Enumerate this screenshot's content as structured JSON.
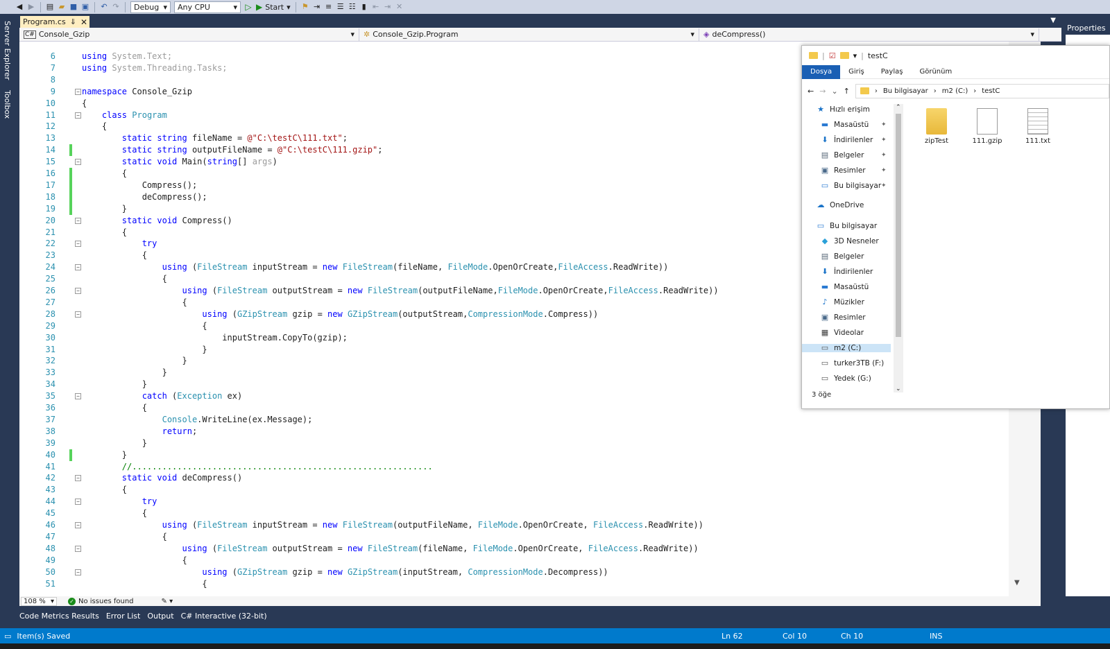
{
  "toolbar": {
    "config": "Debug",
    "platform": "Any CPU",
    "start": "Start"
  },
  "sidebar": {
    "server_explorer": "Server Explorer",
    "toolbox": "Toolbox"
  },
  "tab": {
    "file": "Program.cs",
    "pin": "⇓",
    "close": "✕"
  },
  "nav": {
    "project": "Console_Gzip",
    "class": "Console_Gzip.Program",
    "member": "deCompress()"
  },
  "properties": {
    "title": "Properties"
  },
  "code": {
    "lines": [
      {
        "n": "6",
        "segs": [
          [
            "k",
            "using"
          ],
          [
            "g",
            " System.Text;"
          ]
        ],
        "dim": true
      },
      {
        "n": "7",
        "segs": [
          [
            "k",
            "using"
          ],
          [
            "g",
            " System.Threading.Tasks;"
          ]
        ],
        "dim": true
      },
      {
        "n": "8",
        "segs": []
      },
      {
        "n": "9",
        "segs": [
          [
            "k",
            "namespace"
          ],
          [
            "",
            " Console_Gzip"
          ]
        ],
        "fold": "−"
      },
      {
        "n": "10",
        "segs": [
          [
            "",
            "{"
          ]
        ]
      },
      {
        "n": "11",
        "segs": [
          [
            "",
            "    "
          ],
          [
            "k",
            "class"
          ],
          [
            "",
            " "
          ],
          [
            "t",
            "Program"
          ]
        ],
        "fold": "−"
      },
      {
        "n": "12",
        "segs": [
          [
            "",
            "    {"
          ]
        ]
      },
      {
        "n": "13",
        "segs": [
          [
            "",
            "        "
          ],
          [
            "k",
            "static string"
          ],
          [
            "",
            " fileName = "
          ],
          [
            "s",
            "@\"C:\\testC\\111.txt\""
          ],
          [
            ";"
          ]
        ]
      },
      {
        "n": "14",
        "segs": [
          [
            "",
            "        "
          ],
          [
            "k",
            "static string"
          ],
          [
            "",
            " outputFileName = "
          ],
          [
            "s",
            "@\"C:\\testC\\111.gzip\""
          ],
          [
            ";"
          ]
        ],
        "changed": true
      },
      {
        "n": "15",
        "segs": [
          [
            "",
            "        "
          ],
          [
            "k",
            "static void"
          ],
          [
            "",
            " Main("
          ],
          [
            "k",
            "string"
          ],
          [
            "",
            "[] "
          ],
          [
            "g",
            "args"
          ],
          [
            "",
            ")"
          ]
        ],
        "fold": "−"
      },
      {
        "n": "16",
        "segs": [
          [
            "",
            "        {"
          ]
        ],
        "changed": true
      },
      {
        "n": "17",
        "segs": [
          [
            "",
            "            Compress();"
          ]
        ],
        "changed": true
      },
      {
        "n": "18",
        "segs": [
          [
            "",
            "            deCompress();"
          ]
        ],
        "changed": true
      },
      {
        "n": "19",
        "segs": [
          [
            "",
            "        }"
          ]
        ],
        "changed": true
      },
      {
        "n": "20",
        "segs": [
          [
            "",
            "        "
          ],
          [
            "k",
            "static void"
          ],
          [
            "",
            " Compress()"
          ]
        ],
        "fold": "−"
      },
      {
        "n": "21",
        "segs": [
          [
            "",
            "        {"
          ]
        ]
      },
      {
        "n": "22",
        "segs": [
          [
            "",
            "            "
          ],
          [
            "k",
            "try"
          ]
        ],
        "fold": "−"
      },
      {
        "n": "23",
        "segs": [
          [
            "",
            "            {"
          ]
        ]
      },
      {
        "n": "24",
        "segs": [
          [
            "",
            "                "
          ],
          [
            "k",
            "using"
          ],
          [
            "",
            " ("
          ],
          [
            "t",
            "FileStream"
          ],
          [
            "",
            " inputStream = "
          ],
          [
            "k",
            "new"
          ],
          [
            "",
            " "
          ],
          [
            "t",
            "FileStream"
          ],
          [
            "",
            "(fileName, "
          ],
          [
            "t",
            "FileMode"
          ],
          [
            "",
            ".OpenOrCreate,"
          ],
          [
            "t",
            "FileAccess"
          ],
          [
            "",
            ".ReadWrite))"
          ]
        ],
        "fold": "−"
      },
      {
        "n": "25",
        "segs": [
          [
            "",
            "                {"
          ]
        ]
      },
      {
        "n": "26",
        "segs": [
          [
            "",
            "                    "
          ],
          [
            "k",
            "using"
          ],
          [
            "",
            " ("
          ],
          [
            "t",
            "FileStream"
          ],
          [
            "",
            " outputStream = "
          ],
          [
            "k",
            "new"
          ],
          [
            "",
            " "
          ],
          [
            "t",
            "FileStream"
          ],
          [
            "",
            "(outputFileName,"
          ],
          [
            "t",
            "FileMode"
          ],
          [
            "",
            ".OpenOrCreate,"
          ],
          [
            "t",
            "FileAccess"
          ],
          [
            "",
            ".ReadWrite))"
          ]
        ],
        "fold": "−"
      },
      {
        "n": "27",
        "segs": [
          [
            "",
            "                    {"
          ]
        ]
      },
      {
        "n": "28",
        "segs": [
          [
            "",
            "                        "
          ],
          [
            "k",
            "using"
          ],
          [
            "",
            " ("
          ],
          [
            "t",
            "GZipStream"
          ],
          [
            "",
            " gzip = "
          ],
          [
            "k",
            "new"
          ],
          [
            "",
            " "
          ],
          [
            "t",
            "GZipStream"
          ],
          [
            "",
            "(outputStream,"
          ],
          [
            "t",
            "CompressionMode"
          ],
          [
            "",
            ".Compress))"
          ]
        ],
        "fold": "−"
      },
      {
        "n": "29",
        "segs": [
          [
            "",
            "                        {"
          ]
        ]
      },
      {
        "n": "30",
        "segs": [
          [
            "",
            "                            inputStream.CopyTo(gzip);"
          ]
        ]
      },
      {
        "n": "31",
        "segs": [
          [
            "",
            "                        }"
          ]
        ]
      },
      {
        "n": "32",
        "segs": [
          [
            "",
            "                    }"
          ]
        ]
      },
      {
        "n": "33",
        "segs": [
          [
            "",
            "                }"
          ]
        ]
      },
      {
        "n": "34",
        "segs": [
          [
            "",
            "            }"
          ]
        ]
      },
      {
        "n": "35",
        "segs": [
          [
            "",
            "            "
          ],
          [
            "k",
            "catch"
          ],
          [
            "",
            " ("
          ],
          [
            "t",
            "Exception"
          ],
          [
            "",
            " ex)"
          ]
        ],
        "fold": "−"
      },
      {
        "n": "36",
        "segs": [
          [
            "",
            "            {"
          ]
        ]
      },
      {
        "n": "37",
        "segs": [
          [
            "",
            "                "
          ],
          [
            "t",
            "Console"
          ],
          [
            "",
            ".WriteLine(ex.Message);"
          ]
        ]
      },
      {
        "n": "38",
        "segs": [
          [
            "",
            "                "
          ],
          [
            "k",
            "return"
          ],
          [
            "",
            ";"
          ]
        ]
      },
      {
        "n": "39",
        "segs": [
          [
            "",
            "            }"
          ]
        ]
      },
      {
        "n": "40",
        "segs": [
          [
            "",
            "        }"
          ]
        ],
        "changed": true
      },
      {
        "n": "41",
        "segs": [
          [
            "",
            "        "
          ],
          [
            "c",
            "//............................................................"
          ]
        ]
      },
      {
        "n": "42",
        "segs": [
          [
            "",
            "        "
          ],
          [
            "k",
            "static void"
          ],
          [
            "",
            " deCompress()"
          ]
        ],
        "fold": "−"
      },
      {
        "n": "43",
        "segs": [
          [
            "",
            "        {"
          ]
        ]
      },
      {
        "n": "44",
        "segs": [
          [
            "",
            "            "
          ],
          [
            "k",
            "try"
          ]
        ],
        "fold": "−"
      },
      {
        "n": "45",
        "segs": [
          [
            "",
            "            {"
          ]
        ]
      },
      {
        "n": "46",
        "segs": [
          [
            "",
            "                "
          ],
          [
            "k",
            "using"
          ],
          [
            "",
            " ("
          ],
          [
            "t",
            "FileStream"
          ],
          [
            "",
            " inputStream = "
          ],
          [
            "k",
            "new"
          ],
          [
            "",
            " "
          ],
          [
            "t",
            "FileStream"
          ],
          [
            "",
            "(outputFileName, "
          ],
          [
            "t",
            "FileMode"
          ],
          [
            "",
            ".OpenOrCreate, "
          ],
          [
            "t",
            "FileAccess"
          ],
          [
            "",
            ".ReadWrite))"
          ]
        ],
        "fold": "−"
      },
      {
        "n": "47",
        "segs": [
          [
            "",
            "                {"
          ]
        ]
      },
      {
        "n": "48",
        "segs": [
          [
            "",
            "                    "
          ],
          [
            "k",
            "using"
          ],
          [
            "",
            " ("
          ],
          [
            "t",
            "FileStream"
          ],
          [
            "",
            " outputStream = "
          ],
          [
            "k",
            "new"
          ],
          [
            "",
            " "
          ],
          [
            "t",
            "FileStream"
          ],
          [
            "",
            "(fileName, "
          ],
          [
            "t",
            "FileMode"
          ],
          [
            "",
            ".OpenOrCreate, "
          ],
          [
            "t",
            "FileAccess"
          ],
          [
            "",
            ".ReadWrite))"
          ]
        ],
        "fold": "−"
      },
      {
        "n": "49",
        "segs": [
          [
            "",
            "                    {"
          ]
        ]
      },
      {
        "n": "50",
        "segs": [
          [
            "",
            "                        "
          ],
          [
            "k",
            "using"
          ],
          [
            "",
            " ("
          ],
          [
            "t",
            "GZipStream"
          ],
          [
            "",
            " gzip = "
          ],
          [
            "k",
            "new"
          ],
          [
            "",
            " "
          ],
          [
            "t",
            "GZipStream"
          ],
          [
            "",
            "(inputStream, "
          ],
          [
            "t",
            "CompressionMode"
          ],
          [
            "",
            ".Decompress))"
          ]
        ],
        "fold": "−"
      },
      {
        "n": "51",
        "segs": [
          [
            "",
            "                        {"
          ]
        ]
      }
    ]
  },
  "editor_status": {
    "zoom": "108 %",
    "issues": "No issues found"
  },
  "bottom_tabs": [
    "Code Metrics Results",
    "Error List",
    "Output",
    "C# Interactive (32-bit)"
  ],
  "status": {
    "message": "Item(s) Saved",
    "ln": "Ln 62",
    "col": "Col 10",
    "ch": "Ch 10",
    "ins": "INS"
  },
  "explorer": {
    "title": "testC",
    "ribbon_tabs": [
      "Dosya",
      "Giriş",
      "Paylaş",
      "Görünüm"
    ],
    "address": [
      "Bu bilgisayar",
      "m2 (C:)",
      "testC"
    ],
    "nav": [
      {
        "label": "Hızlı erişim",
        "icon": "star-icon",
        "indent": 0
      },
      {
        "label": "Masaüstü",
        "icon": "desktop-icon",
        "indent": 1,
        "pin": true
      },
      {
        "label": "İndirilenler",
        "icon": "download-icon",
        "indent": 1,
        "pin": true
      },
      {
        "label": "Belgeler",
        "icon": "document-icon",
        "indent": 1,
        "pin": true
      },
      {
        "label": "Resimler",
        "icon": "pictures-icon",
        "indent": 1,
        "pin": true
      },
      {
        "label": "Bu bilgisayar",
        "icon": "computer-icon",
        "indent": 1,
        "pin": true
      },
      {
        "label": "OneDrive",
        "icon": "cloud-icon",
        "indent": 0
      },
      {
        "label": "Bu bilgisayar",
        "icon": "computer-icon",
        "indent": 0
      },
      {
        "label": "3D Nesneler",
        "icon": "cube-icon",
        "indent": 1
      },
      {
        "label": "Belgeler",
        "icon": "document-icon",
        "indent": 1
      },
      {
        "label": "İndirilenler",
        "icon": "download-icon",
        "indent": 1
      },
      {
        "label": "Masaüstü",
        "icon": "desktop-icon",
        "indent": 1
      },
      {
        "label": "Müzikler",
        "icon": "music-icon",
        "indent": 1
      },
      {
        "label": "Resimler",
        "icon": "pictures-icon",
        "indent": 1
      },
      {
        "label": "Videolar",
        "icon": "video-icon",
        "indent": 1
      },
      {
        "label": "m2 (C:)",
        "icon": "drive-icon",
        "indent": 1,
        "selected": true
      },
      {
        "label": "turker3TB (F:)",
        "icon": "drive-icon",
        "indent": 1
      },
      {
        "label": "Yedek (G:)",
        "icon": "drive-icon",
        "indent": 1
      }
    ],
    "files": [
      {
        "name": "zipTest",
        "icon": "folder-icon"
      },
      {
        "name": "111.gzip",
        "icon": "file-icon"
      },
      {
        "name": "111.txt",
        "icon": "text-file-icon"
      }
    ],
    "item_count": "3 öğe"
  }
}
